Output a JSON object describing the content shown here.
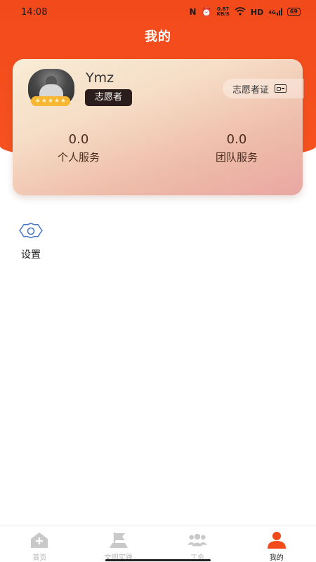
{
  "status_bar": {
    "time": "14:08",
    "speed_value": "0.87",
    "speed_unit": "KB/S",
    "network": "HD",
    "signal_label": "4G",
    "battery": "69"
  },
  "page": {
    "title": "我的"
  },
  "profile": {
    "username": "Ymz",
    "role": "志愿者",
    "certificate_label": "志愿者证",
    "rating_stars": 5,
    "stats": [
      {
        "value": "0.0",
        "label": "个人服务"
      },
      {
        "value": "0.0",
        "label": "团队服务"
      }
    ]
  },
  "menu": {
    "settings_label": "设置"
  },
  "tabbar": {
    "tabs": [
      {
        "label": "首页",
        "icon": "home-icon",
        "active": false
      },
      {
        "label": "文明实践",
        "icon": "flag-icon",
        "active": false
      },
      {
        "label": "工会",
        "icon": "group-icon",
        "active": false
      },
      {
        "label": "我的",
        "icon": "person-icon",
        "active": true
      }
    ]
  },
  "colors": {
    "accent": "#F34A1B",
    "badge_dark": "#2B1D1B",
    "star_gold": "#F7B733",
    "settings_icon_blue": "#4A78C9"
  }
}
